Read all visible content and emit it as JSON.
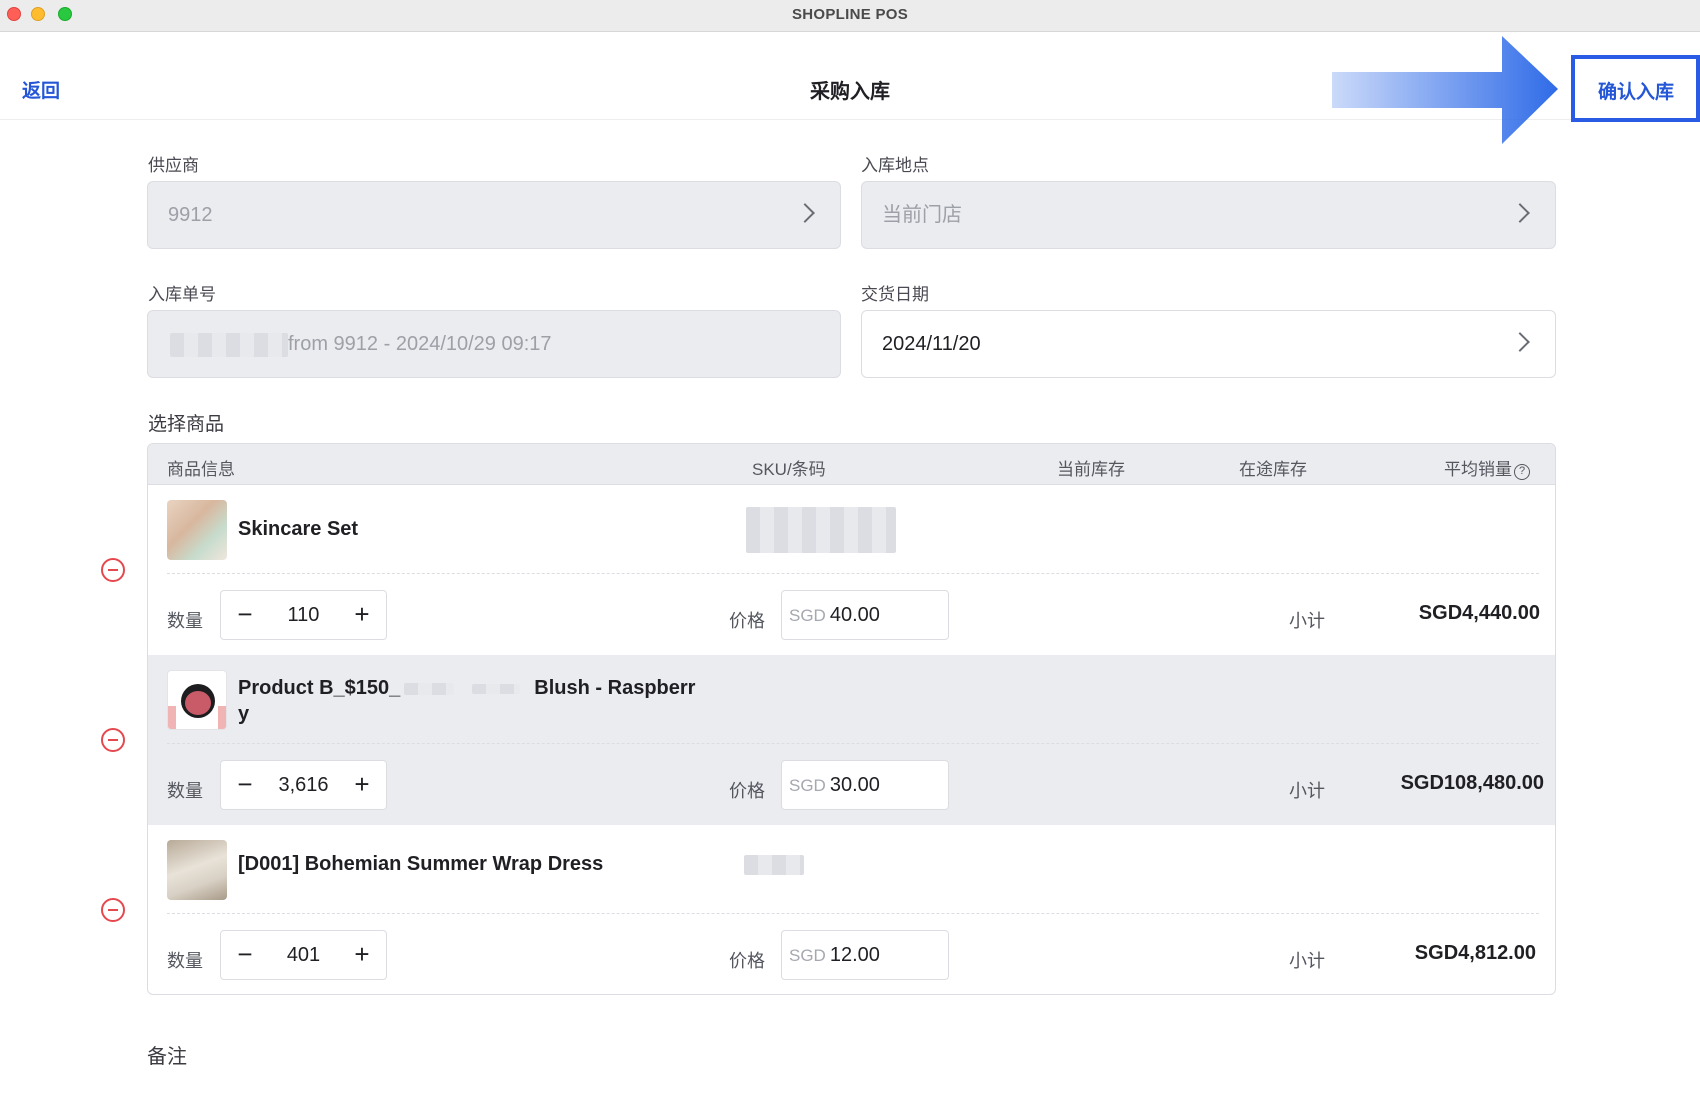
{
  "window": {
    "title": "SHOPLINE POS"
  },
  "header": {
    "back_label": "返回",
    "title": "采购入库",
    "confirm_label": "确认入库"
  },
  "form": {
    "supplier": {
      "label": "供应商",
      "value": "9912"
    },
    "location": {
      "label": "入库地点",
      "value": "当前门店"
    },
    "order_no": {
      "label": "入库单号",
      "value": "from 9912 - 2024/10/29 09:17"
    },
    "delivery_date": {
      "label": "交货日期",
      "value": "2024/11/20"
    }
  },
  "products_section": {
    "label": "选择商品",
    "columns": {
      "info": "商品信息",
      "sku": "SKU/条码",
      "current_stock": "当前库存",
      "in_transit": "在途库存",
      "avg_sales": "平均销量"
    },
    "qty_label": "数量",
    "price_label": "价格",
    "subtotal_label": "小计",
    "currency": "SGD",
    "items": [
      {
        "name": "Skincare Set",
        "qty": "110",
        "price": "40.00",
        "subtotal": "SGD4,440.00"
      },
      {
        "name": "Product B_$150_",
        "name_suffix": "Blush - Raspberr",
        "name_line2": "y",
        "qty": "3,616",
        "price": "30.00",
        "subtotal": "SGD108,480.00"
      },
      {
        "name": "[D001] Bohemian Summer Wrap Dress",
        "qty": "401",
        "price": "12.00",
        "subtotal": "SGD4,812.00"
      }
    ]
  },
  "notes": {
    "label": "备注"
  },
  "colors": {
    "accent": "#2456d6",
    "remove": "#e5484d",
    "field_bg": "#ebecf0"
  }
}
